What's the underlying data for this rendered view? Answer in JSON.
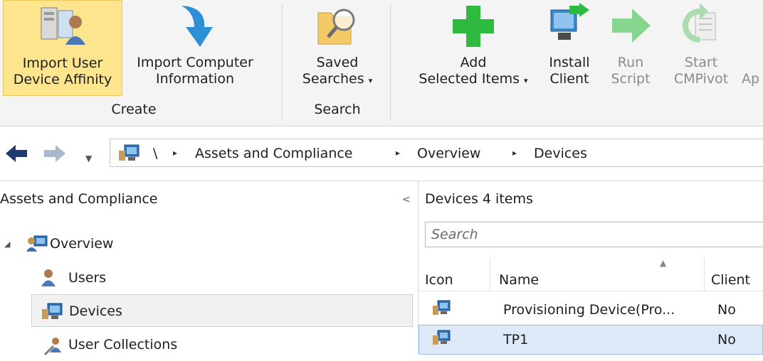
{
  "ribbon": {
    "buttons": [
      {
        "line1": "Import User",
        "line2": "Device Affinity",
        "icon": "import-user-device-affinity-icon"
      },
      {
        "line1": "Import Computer",
        "line2": "Information",
        "icon": "import-computer-information-icon"
      },
      {
        "line1": "Saved",
        "line2": "Searches",
        "icon": "saved-searches-icon"
      },
      {
        "line1": "Add",
        "line2": "Selected Items",
        "icon": "add-icon"
      },
      {
        "line1": "Install",
        "line2": "Client",
        "icon": "install-client-icon"
      },
      {
        "line1": "Run",
        "line2": "Script",
        "icon": "run-script-icon"
      },
      {
        "line1": "Start",
        "line2": "CMPivot",
        "icon": "start-cmpivot-icon"
      },
      {
        "line1": "",
        "line2": "Ap",
        "icon": ""
      }
    ],
    "groups": {
      "create": "Create",
      "search": "Search"
    },
    "caret": "▾"
  },
  "address": {
    "root": "\\",
    "crumbs": [
      "Assets and Compliance",
      "Overview",
      "Devices"
    ],
    "separator": "▸"
  },
  "nav": {
    "title": "Assets and Compliance",
    "collapse_glyph": "<",
    "items": [
      {
        "label": "Overview",
        "icon": "overview-icon"
      },
      {
        "label": "Users",
        "icon": "users-icon"
      },
      {
        "label": "Devices",
        "icon": "devices-icon"
      },
      {
        "label": "User Collections",
        "icon": "user-collections-icon"
      }
    ]
  },
  "content": {
    "title": "Devices 4 items",
    "search_placeholder": "Search",
    "columns": [
      "Icon",
      "Name",
      "Client"
    ],
    "rows": [
      {
        "name": "Provisioning Device(Pro...",
        "client": "No"
      },
      {
        "name": "TP1",
        "client": "No"
      }
    ]
  },
  "colors": {
    "ribbon_bg": "#f4f4f4",
    "active_button": "#fde58d",
    "selected_row": "#dde9f7",
    "add_green": "#2dba3f",
    "arrow_blue": "#2d8fd6"
  }
}
